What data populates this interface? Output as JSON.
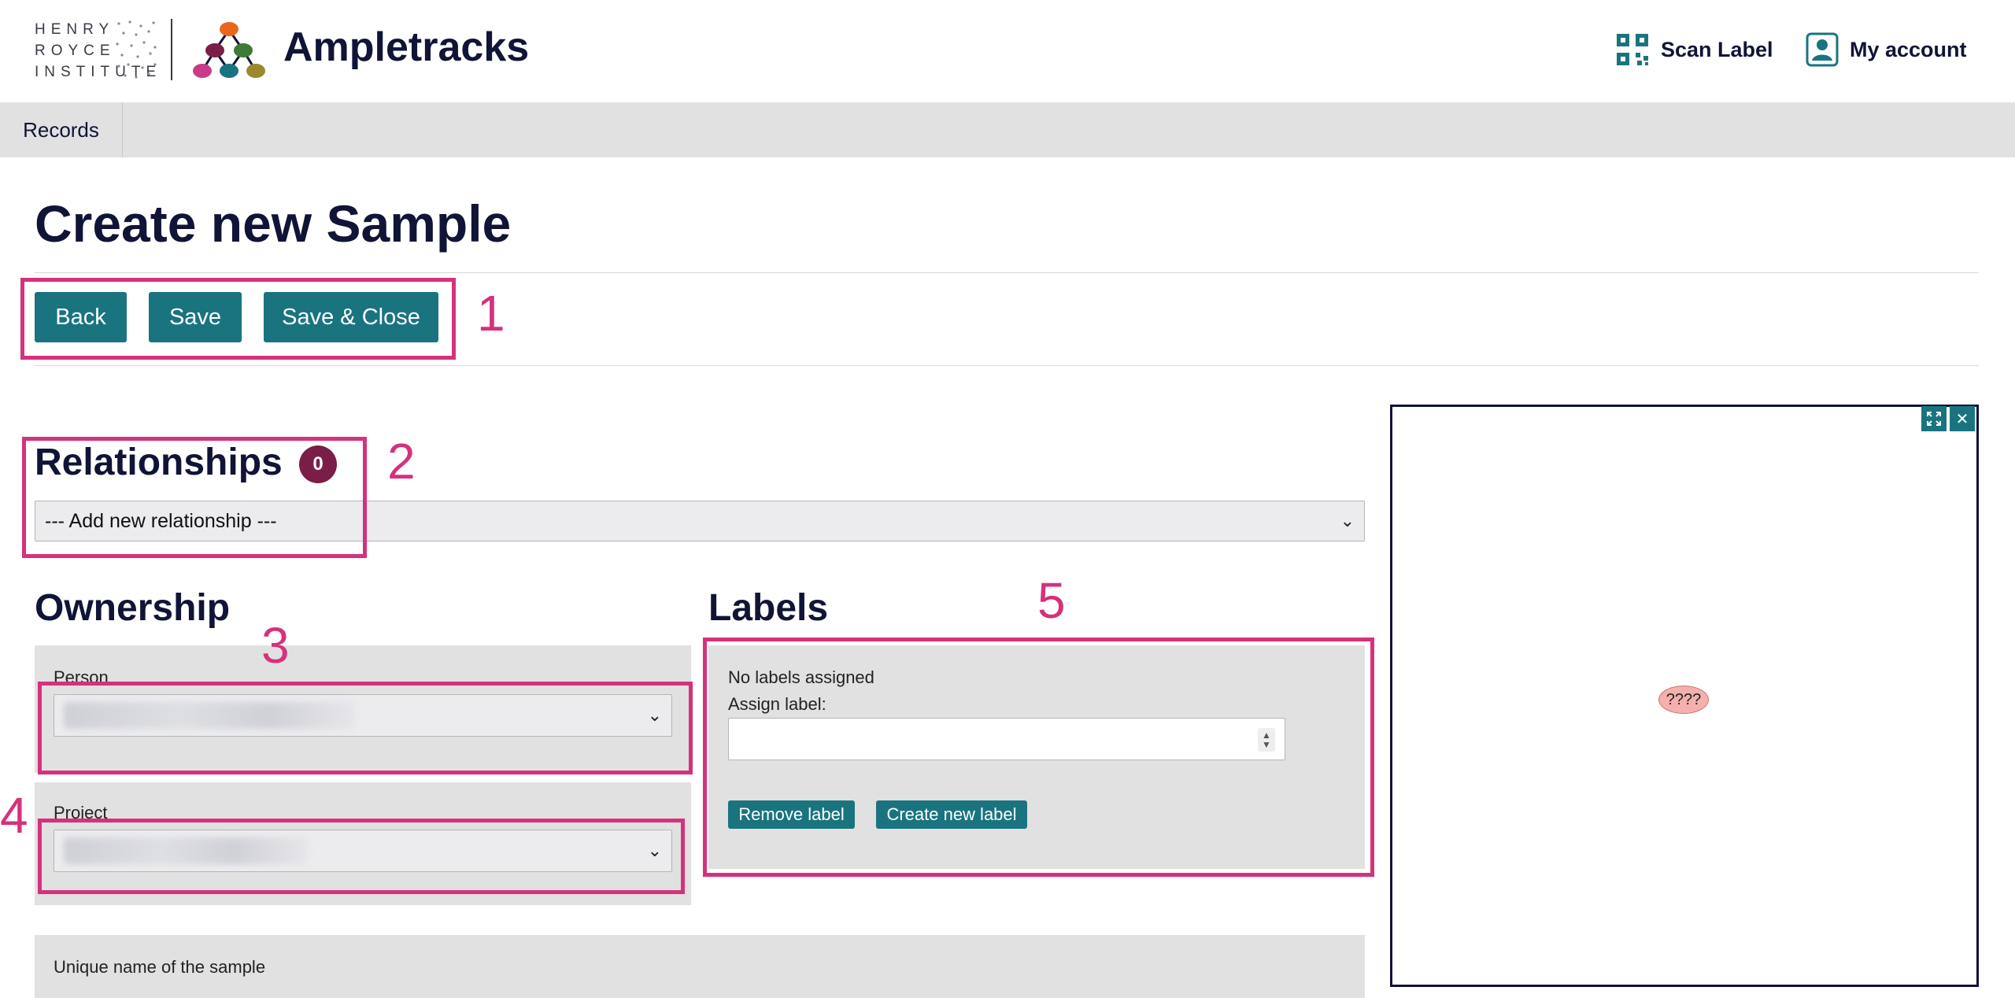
{
  "header": {
    "institute_lines": [
      "HENRY",
      "ROYCE",
      "INSTITUTE"
    ],
    "app_name": "Ampletracks",
    "scan_label": "Scan Label",
    "account_label": "My account"
  },
  "nav": {
    "items": [
      {
        "label": "Records"
      }
    ]
  },
  "page": {
    "title": "Create new Sample"
  },
  "toolbar": {
    "back_label": "Back",
    "save_label": "Save",
    "save_close_label": "Save & Close"
  },
  "relationships": {
    "title": "Relationships",
    "count": "0",
    "add_select_value": "--- Add new relationship ---"
  },
  "ownership": {
    "title": "Ownership",
    "person_label": "Person",
    "project_label": "Project"
  },
  "labels": {
    "title": "Labels",
    "status_text": "No labels assigned",
    "assign_label": "Assign label:",
    "remove_button": "Remove label",
    "create_button": "Create new label"
  },
  "unique_name": {
    "label": "Unique name of the sample"
  },
  "graph": {
    "node_text": "????"
  },
  "annotations": [
    "1",
    "2",
    "3",
    "4",
    "5"
  ],
  "colors": {
    "teal": "#1a7480",
    "navy": "#101436",
    "annotation_pink": "#d6317c",
    "badge": "#7a1e48",
    "panel_grey": "#e1e1e1"
  }
}
